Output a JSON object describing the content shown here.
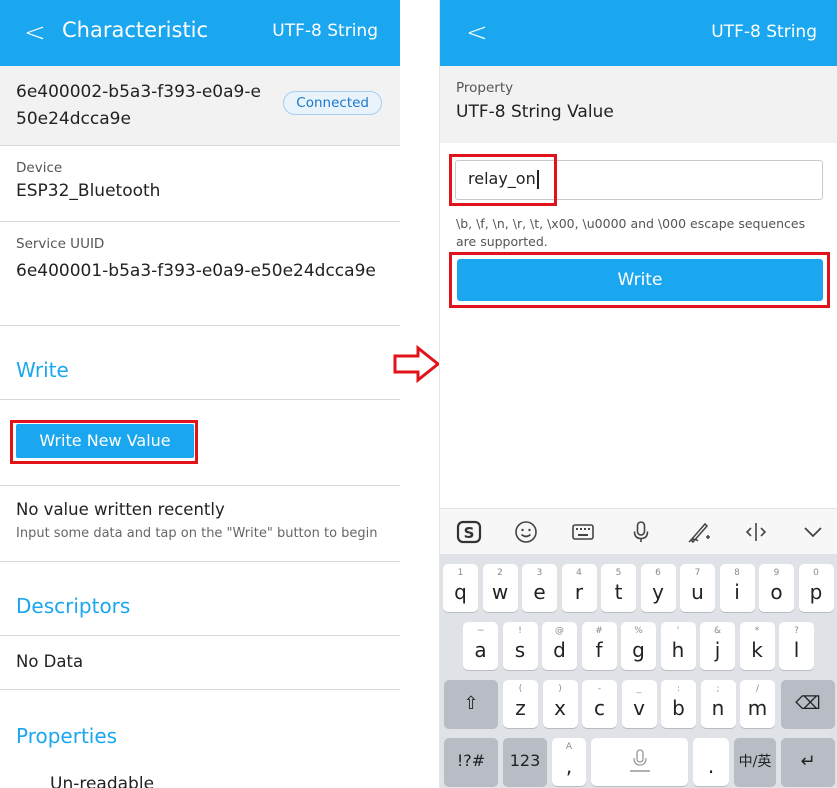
{
  "left": {
    "header": {
      "back_glyph": "<",
      "title": "Characteristic",
      "right_label": "UTF-8 String"
    },
    "uuid": "6e400002-b5a3-f393-e0a9-e50e24dcca9e",
    "status_badge": "Connected",
    "device": {
      "label": "Device",
      "value": "ESP32_Bluetooth"
    },
    "service": {
      "label": "Service UUID",
      "value": "6e400001-b5a3-f393-e0a9-e50e24dcca9e"
    },
    "write_section": "Write",
    "write_new_button": "Write New Value",
    "last_write": {
      "title": "No value written recently",
      "hint": "Input some data and tap on the \"Write\" button to begin"
    },
    "descriptors_section": "Descriptors",
    "descriptors_value": "No Data",
    "properties_section": "Properties",
    "properties_first_item": "Un-readable"
  },
  "right": {
    "header": {
      "back_glyph": "<",
      "right_label": "UTF-8 String"
    },
    "property": {
      "label": "Property",
      "value": "UTF-8 String Value"
    },
    "input_value": "relay_on",
    "escape_note": "\\b, \\f, \\n, \\r, \\t, \\x00, \\u0000 and \\000 escape sequences are supported.",
    "write_button": "Write"
  },
  "keyboard": {
    "toolbar_icons": [
      "sogou-logo-icon",
      "emoji-icon",
      "keyboard-icon",
      "microphone-icon",
      "handwriting-icon",
      "cursor-move-icon",
      "collapse-icon"
    ],
    "row1": [
      {
        "k": "q",
        "s": "1"
      },
      {
        "k": "w",
        "s": "2"
      },
      {
        "k": "e",
        "s": "3"
      },
      {
        "k": "r",
        "s": "4"
      },
      {
        "k": "t",
        "s": "5"
      },
      {
        "k": "y",
        "s": "6"
      },
      {
        "k": "u",
        "s": "7"
      },
      {
        "k": "i",
        "s": "8"
      },
      {
        "k": "o",
        "s": "9"
      },
      {
        "k": "p",
        "s": "0"
      }
    ],
    "row2": [
      {
        "k": "a",
        "s": "~"
      },
      {
        "k": "s",
        "s": "!"
      },
      {
        "k": "d",
        "s": "@"
      },
      {
        "k": "f",
        "s": "#"
      },
      {
        "k": "g",
        "s": "%"
      },
      {
        "k": "h",
        "s": "'"
      },
      {
        "k": "j",
        "s": "&"
      },
      {
        "k": "k",
        "s": "*"
      },
      {
        "k": "l",
        "s": "?"
      }
    ],
    "row3": [
      {
        "k": "z",
        "s": "("
      },
      {
        "k": "x",
        "s": ")"
      },
      {
        "k": "c",
        "s": "-"
      },
      {
        "k": "v",
        "s": "_"
      },
      {
        "k": "b",
        "s": ":"
      },
      {
        "k": "n",
        "s": ";"
      },
      {
        "k": "m",
        "s": "/"
      }
    ],
    "shift_glyph": "⇧",
    "backspace_glyph": "⌫",
    "symbols_key": "!?#",
    "numbers_key": "123",
    "comma_key": {
      "k": ",",
      "s": "A"
    },
    "period_key": ".",
    "lang_key": "中/英",
    "enter_glyph": "↵"
  }
}
